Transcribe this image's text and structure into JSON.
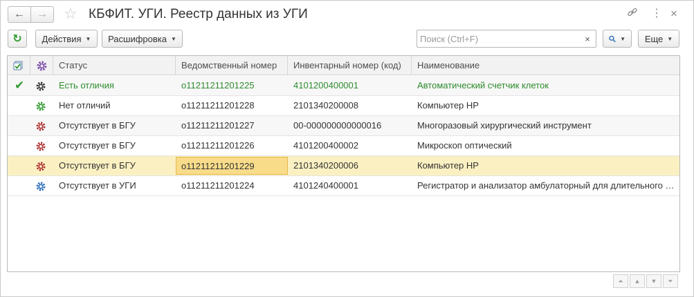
{
  "window": {
    "title": "КБФИТ. УГИ. Реестр данных из УГИ",
    "back_icon": "←",
    "forward_icon": "→",
    "star_icon": "☆",
    "link_icon": "🔗",
    "menu_icon": "⋮",
    "close_icon": "×"
  },
  "toolbar": {
    "refresh_icon": "↻",
    "actions_label": "Действия",
    "decode_label": "Расшифровка",
    "search_placeholder": "Поиск (Ctrl+F)",
    "search_value": "",
    "search_clear_icon": "×",
    "search_icon": "🔍",
    "more_label": "Еще",
    "caret": "▼"
  },
  "table": {
    "columns": {
      "status": "Статус",
      "dept_number": "Ведомственный номер",
      "inventory_number": "Инвентарный номер (код)",
      "name": "Наименование"
    },
    "rows": [
      {
        "status": "Есть отличия",
        "dept_number": "о11211211201225",
        "inventory_number": "4101200400001",
        "name": "Автоматический счетчик клеток",
        "checked": true,
        "gear_color": "#333333"
      },
      {
        "status": "Нет отличий",
        "dept_number": "о11211211201228",
        "inventory_number": "2101340200008",
        "name": "Компьютер HP",
        "checked": false,
        "gear_color": "#2e9a2e"
      },
      {
        "status": "Отсутствует в БГУ",
        "dept_number": "о11211211201227",
        "inventory_number": "00-000000000000016",
        "name": "Многоразовый хирургический инструмент",
        "checked": false,
        "gear_color": "#b03030"
      },
      {
        "status": "Отсутствует в БГУ",
        "dept_number": "о11211211201226",
        "inventory_number": "4101200400002",
        "name": "Микроскоп оптический",
        "checked": false,
        "gear_color": "#b03030"
      },
      {
        "status": "Отсутствует в БГУ",
        "dept_number": "о11211211201229",
        "inventory_number": "2101340200006",
        "name": "Компьютер HP",
        "checked": false,
        "gear_color": "#b03030"
      },
      {
        "status": "Отсутствует в УГИ",
        "dept_number": "о11211211201224",
        "inventory_number": "4101240400001",
        "name": "Регистратор и анализатор амбулаторный для длительного …",
        "checked": false,
        "gear_color": "#2a6ebb"
      }
    ],
    "check_icon": "✔"
  },
  "scroll": {
    "first_icon": "⏶",
    "up_icon": "▲",
    "down_icon": "▼",
    "last_icon": "⏷"
  },
  "colors": {
    "green_text": "#2e8b2e",
    "selected_row": "#fbf0c2",
    "focused_cell": "#f8dc8a"
  }
}
